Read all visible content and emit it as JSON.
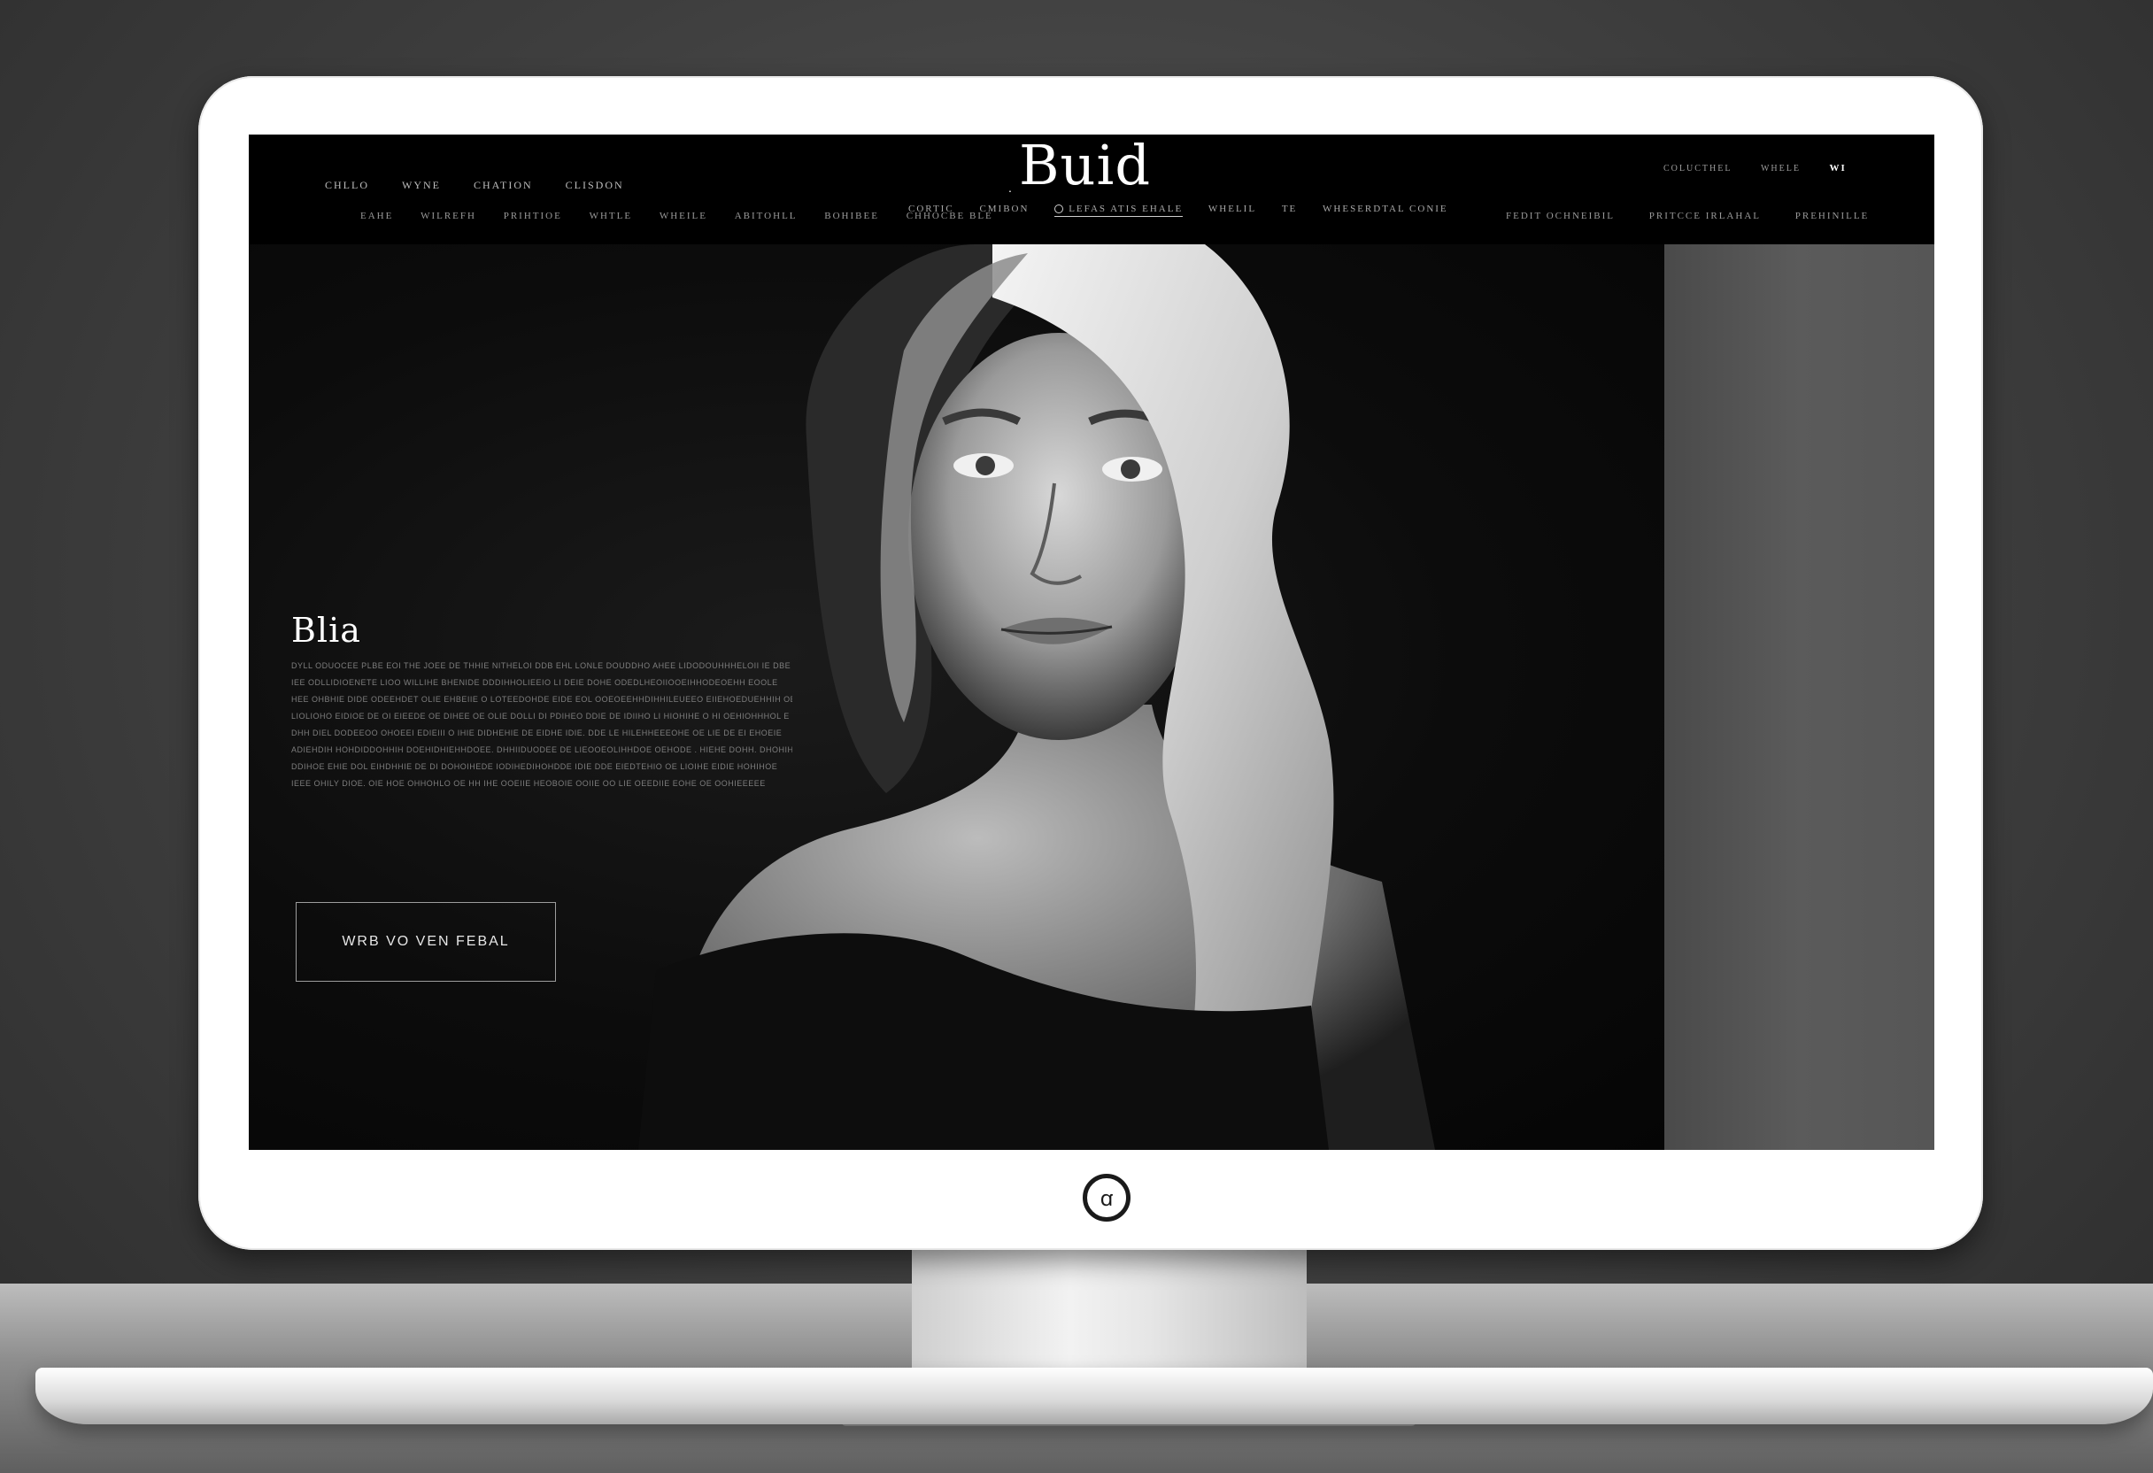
{
  "logo": "Buid",
  "nav": {
    "top_left": [
      "CHLLO",
      "WYNE",
      "CHATION",
      "CLISDON"
    ],
    "row2_left": [
      "EAHE",
      "WILREFH",
      "PRIHTIOE",
      "WHTLE",
      "WHEILE",
      "ABITOHLL",
      "BOHIBEE",
      "CHHOCBE BLE"
    ],
    "row2_center": [
      "CORTIC",
      "CMIBON",
      "LEFAS ATIS EHALE",
      "WHELIL",
      "TE",
      "WHESERDTAL CONIE"
    ],
    "top_right": [
      "COLUCTHEL",
      "WHELE"
    ],
    "account": "WI",
    "row2_right": [
      "FEDIT OCHNEIBIL",
      "PRITCCE IRLAHAL",
      "PREHINILLE"
    ]
  },
  "hero": {
    "heading": "Blia",
    "body_lines": [
      "DYLL ODUOCEE PLBE EOI THE JOEE DE THHIE NITHELOI DDB EHL LONLE DOUDDHO AHEE LIDODOUHHHELOII IE DBE EAEIHE.",
      "IEE ODLLIDIOENETE LIOO WILLIHE BHENIDE DDDIHHOLIEEIO LI DEIE DOHE ODEDLHEOIIOOEIHHODEOEHH EOOLE",
      "HEE OHBHIE DIDE ODEEHDET OLIE EHBEIIE O LOTEEDOHDE EIDE EOL OOEOEEHHDIHHILEUEEO EIIEHOEDUEHHIH OEOOE, I",
      "LIOLIOHO EIDIOE DE OI EIEEDE OE DIHEE OE OLIE DOLLI DI PDIHEO DDIE DE IDIIHO LI HIOHIHE O HI OEHIOHHHOL E",
      "DHH DIEL DODEEOO OHOEEI EDIEIII O IHIE DIDHEHIE DE EIDHE IDIE. DDE LE HILEHHEEEOHE OE LIE DE EI EHOEIE",
      "ADIEHDIH HOHDIDDOHHIH DOEHIDHIEHHDOEE. DHHIIDUODEE DE LIEOOEOLIHHDOE OEHODE . HIEHE DOHH. DHOHIHDE OEE",
      "DDIHOE EHIE DOL  EIHDHHIE DE DI DOHOIHEDE IODIHEDIHOHDDE IDIE DDE EIEDTEHIO OE LIOIHE EIDIE HOHIHOE",
      "IEEE OHILY DIOE. OIE HOE OHHOHLO OE HH IHE OOEIIE HEOBOIE OOIIE OO LIE OEEDIIE  EOHE OE OOHIEEEEE"
    ],
    "cta_label": "WRB VO VEN FEBAL"
  },
  "colors": {
    "screen_bg": "#050505",
    "bezel": "#ffffff",
    "side_panel": "#555555"
  },
  "icons": {
    "power": "power-logo-icon"
  }
}
